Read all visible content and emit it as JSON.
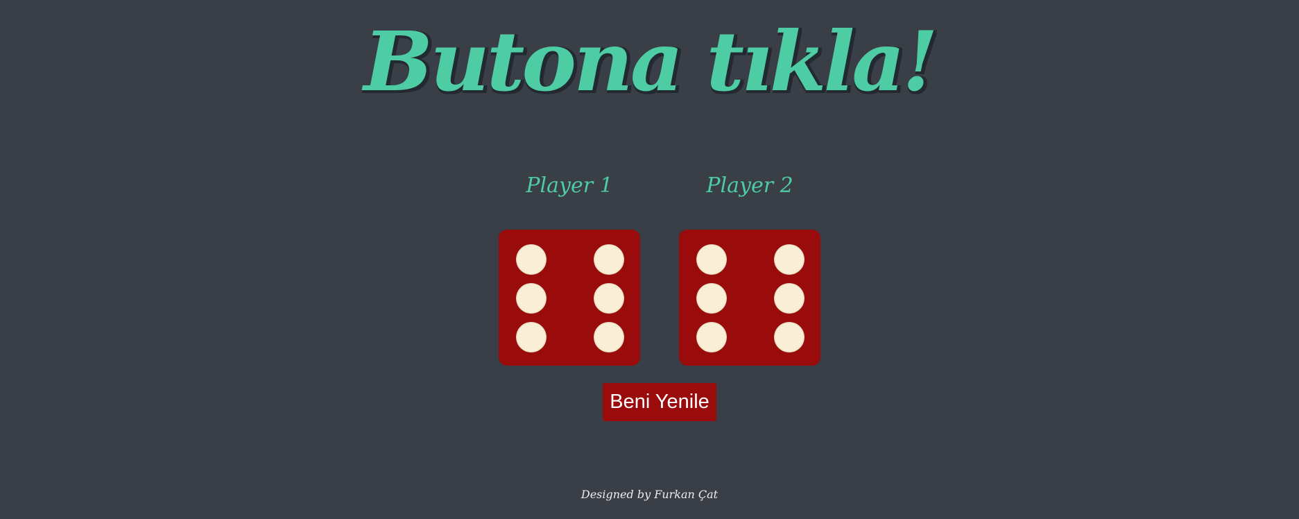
{
  "page": {
    "title": "Butona tıkla!"
  },
  "players": [
    {
      "label": "Player 1",
      "die_value": 6
    },
    {
      "label": "Player 2",
      "die_value": 6
    }
  ],
  "controls": {
    "refresh_label": "Beni Yenile"
  },
  "footer": {
    "credit": "Designed by Furkan Çat"
  },
  "colors": {
    "background": "#393e47",
    "accent": "#4ecca3",
    "die": "#9a0b0b",
    "pip": "#f9efd6",
    "button": "#9a0b0b"
  }
}
